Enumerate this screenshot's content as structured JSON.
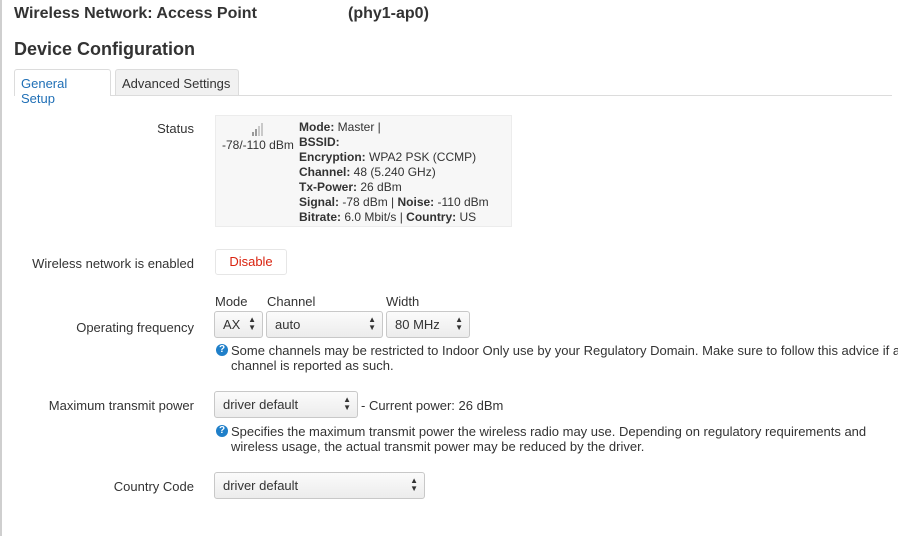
{
  "header": {
    "title": "Wireless Network: Access Point",
    "subtitle": "(phy1-ap0)",
    "section": "Device Configuration"
  },
  "tabs": [
    {
      "label": "General Setup",
      "active": true
    },
    {
      "label": "Advanced Settings",
      "active": false
    }
  ],
  "status": {
    "label": "Status",
    "signal_text": "-78/-110 dBm",
    "lines": [
      {
        "k": "Mode:",
        "v": " Master |"
      },
      {
        "k": "BSSID:",
        "v": ""
      },
      {
        "k": "Encryption:",
        "v": " WPA2 PSK (CCMP)"
      },
      {
        "k": "Channel:",
        "v": " 48 (5.240 GHz)"
      },
      {
        "k": "Tx-Power:",
        "v": " 26 dBm"
      }
    ],
    "signal_line": {
      "k1": "Signal:",
      "v1": " -78 dBm | ",
      "k2": "Noise:",
      "v2": " -110 dBm"
    },
    "bitrate_line": {
      "k1": "Bitrate:",
      "v1": " 6.0 Mbit/s | ",
      "k2": "Country:",
      "v2": " US"
    }
  },
  "enabled": {
    "label": "Wireless network is enabled",
    "button": "Disable"
  },
  "frequency": {
    "label": "Operating frequency",
    "mode_label": "Mode",
    "channel_label": "Channel",
    "width_label": "Width",
    "mode_value": "AX",
    "channel_value": "auto",
    "width_value": "80 MHz",
    "help": "Some channels may be restricted to Indoor Only use by your Regulatory Domain. Make sure to follow this advice if a channel is reported as such."
  },
  "txpower": {
    "label": "Maximum transmit power",
    "value": "driver default",
    "current": "- Current power: 26 dBm",
    "help": "Specifies the maximum transmit power the wireless radio may use. Depending on regulatory requirements and wireless usage, the actual transmit power may be reduced by the driver."
  },
  "country": {
    "label": "Country Code",
    "value": "driver default"
  },
  "colors": {
    "accent": "#1f6fb6",
    "danger": "#d9230f",
    "help_icon": "#1f7fc9"
  },
  "icons": {
    "signal": "signal-bars-icon",
    "help": "question-circle-icon",
    "select": "updown-arrows-icon"
  }
}
